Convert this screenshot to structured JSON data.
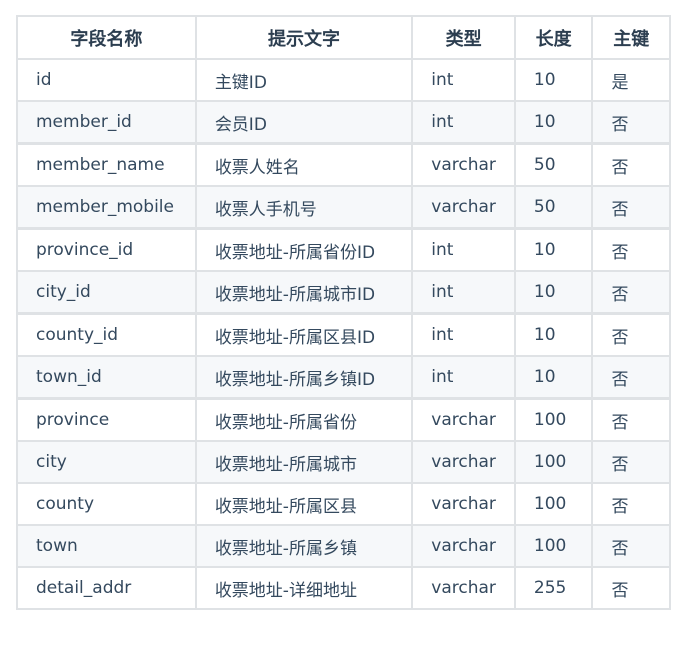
{
  "table": {
    "headers": [
      "字段名称",
      "提示文字",
      "类型",
      "长度",
      "主键"
    ],
    "rows": [
      {
        "field": "id",
        "label": "主键ID",
        "type": "int",
        "length": "10",
        "pk": "是"
      },
      {
        "field": "member_id",
        "label": "会员ID",
        "type": "int",
        "length": "10",
        "pk": "否"
      },
      {
        "field": "member_name",
        "label": "收票人姓名",
        "type": "varchar",
        "length": "50",
        "pk": "否"
      },
      {
        "field": "member_mobile",
        "label": "收票人手机号",
        "type": "varchar",
        "length": "50",
        "pk": "否"
      },
      {
        "field": "province_id",
        "label": "收票地址-所属省份ID",
        "type": "int",
        "length": "10",
        "pk": "否"
      },
      {
        "field": "city_id",
        "label": "收票地址-所属城市ID",
        "type": "int",
        "length": "10",
        "pk": "否"
      },
      {
        "field": "county_id",
        "label": "收票地址-所属区县ID",
        "type": "int",
        "length": "10",
        "pk": "否"
      },
      {
        "field": "town_id",
        "label": "收票地址-所属乡镇ID",
        "type": "int",
        "length": "10",
        "pk": "否"
      },
      {
        "field": "province",
        "label": "收票地址-所属省份",
        "type": "varchar",
        "length": "100",
        "pk": "否"
      },
      {
        "field": "city",
        "label": "收票地址-所属城市",
        "type": "varchar",
        "length": "100",
        "pk": "否"
      },
      {
        "field": "county",
        "label": "收票地址-所属区县",
        "type": "varchar",
        "length": "100",
        "pk": "否"
      },
      {
        "field": "town",
        "label": "收票地址-所属乡镇",
        "type": "varchar",
        "length": "100",
        "pk": "否"
      },
      {
        "field": "detail_addr",
        "label": "收票地址-详细地址",
        "type": "varchar",
        "length": "255",
        "pk": "否"
      }
    ]
  }
}
